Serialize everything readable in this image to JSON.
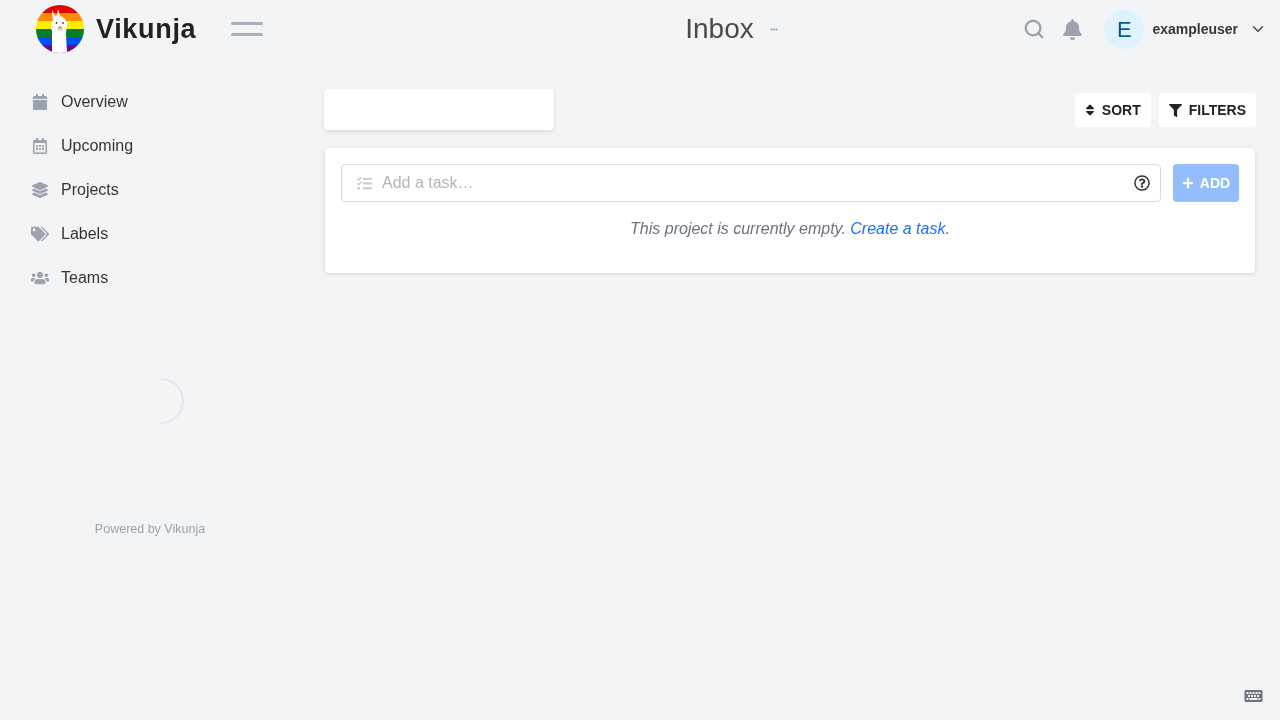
{
  "header": {
    "brand": "Vikunja",
    "title": "Inbox",
    "user": {
      "initial": "E",
      "name": "exampleuser"
    }
  },
  "sidebar": {
    "items": [
      {
        "label": "Overview",
        "selected": false
      },
      {
        "label": "Upcoming",
        "selected": false
      },
      {
        "label": "Projects",
        "selected": false
      },
      {
        "label": "Labels",
        "selected": false
      },
      {
        "label": "Teams",
        "selected": false
      }
    ],
    "footer": "Powered by Vikunja"
  },
  "toolbar": {
    "buttons": [
      {
        "label": "SORT"
      },
      {
        "label": "FILTERS"
      }
    ]
  },
  "task_input": {
    "placeholder": "Add a task…",
    "add_button": {
      "label": "ADD",
      "disabled": true
    }
  },
  "empty_message": {
    "text": "This project is currently empty.",
    "link": "Create a task."
  }
}
